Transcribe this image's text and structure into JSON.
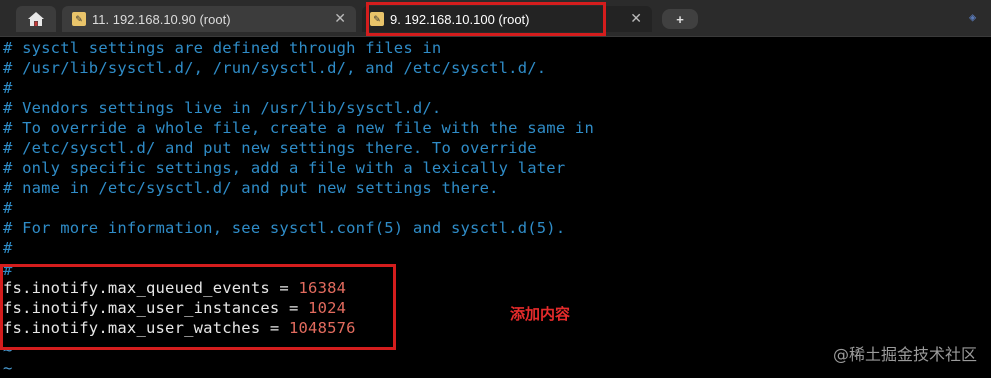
{
  "tabs": [
    {
      "label": "11. 192.168.10.90 (root)",
      "active": false
    },
    {
      "label": "9. 192.168.10.100 (root)",
      "active": true
    }
  ],
  "new_tab_symbol": "+",
  "terminal": {
    "comment_lines": [
      "# sysctl settings are defined through files in",
      "# /usr/lib/sysctl.d/, /run/sysctl.d/, and /etc/sysctl.d/.",
      "#",
      "# Vendors settings live in /usr/lib/sysctl.d/.",
      "# To override a whole file, create a new file with the same in",
      "# /etc/sysctl.d/ and put new settings there. To override",
      "# only specific settings, add a file with a lexically later",
      "# name in /etc/sysctl.d/ and put new settings there.",
      "#",
      "# For more information, see sysctl.conf(5) and sysctl.d(5).",
      "#",
      "#"
    ],
    "settings": [
      {
        "key": "fs.inotify.max_queued_events = ",
        "value": "16384"
      },
      {
        "key": "fs.inotify.max_user_instances = ",
        "value": "1024"
      },
      {
        "key": "fs.inotify.max_user_watches = ",
        "value": "1048576"
      }
    ],
    "tilde_lines": [
      "~",
      "~"
    ]
  },
  "annotation": "添加内容",
  "watermark": "@稀土掘金技术社区",
  "colors": {
    "comment": "#2f8cc7",
    "value": "#e26b5e",
    "highlight_box": "#d41d1d"
  }
}
